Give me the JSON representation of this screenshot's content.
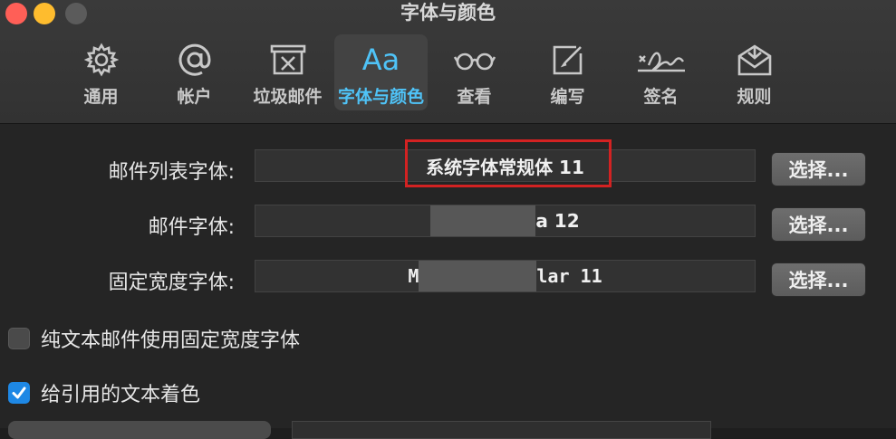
{
  "window": {
    "title": "字体与颜色"
  },
  "toolbar": {
    "items": [
      {
        "label": "通用",
        "icon": "gear-icon",
        "active": false
      },
      {
        "label": "帐户",
        "icon": "at-icon",
        "active": false
      },
      {
        "label": "垃圾邮件",
        "icon": "junk-tray-icon",
        "active": false
      },
      {
        "label": "字体与颜色",
        "icon": "font-aa-icon",
        "icon_text": "Aa",
        "active": true
      },
      {
        "label": "查看",
        "icon": "glasses-icon",
        "active": false
      },
      {
        "label": "编写",
        "icon": "compose-icon",
        "active": false
      },
      {
        "label": "签名",
        "icon": "signature-icon",
        "active": false
      },
      {
        "label": "规则",
        "icon": "rules-envelope-icon",
        "active": false
      }
    ],
    "accent_color": "#4fc3f7"
  },
  "fonts": {
    "message_list": {
      "label": "邮件列表字体:",
      "value": "系统字体常规体 11",
      "button": "选择..."
    },
    "message": {
      "label": "邮件字体:",
      "value_suffix": "a 12",
      "button": "选择..."
    },
    "fixed_width": {
      "label": "固定宽度字体:",
      "value_prefix": "M",
      "value_suffix": "lar 11",
      "button": "选择..."
    }
  },
  "options": {
    "plain_text_fixed": {
      "label": "纯文本邮件使用固定宽度字体",
      "checked": false
    },
    "color_quoted": {
      "label": "给引用的文本着色",
      "checked": true
    }
  },
  "colors": {
    "highlight_box": "#d32222",
    "checkbox_on": "#1e88e5"
  }
}
